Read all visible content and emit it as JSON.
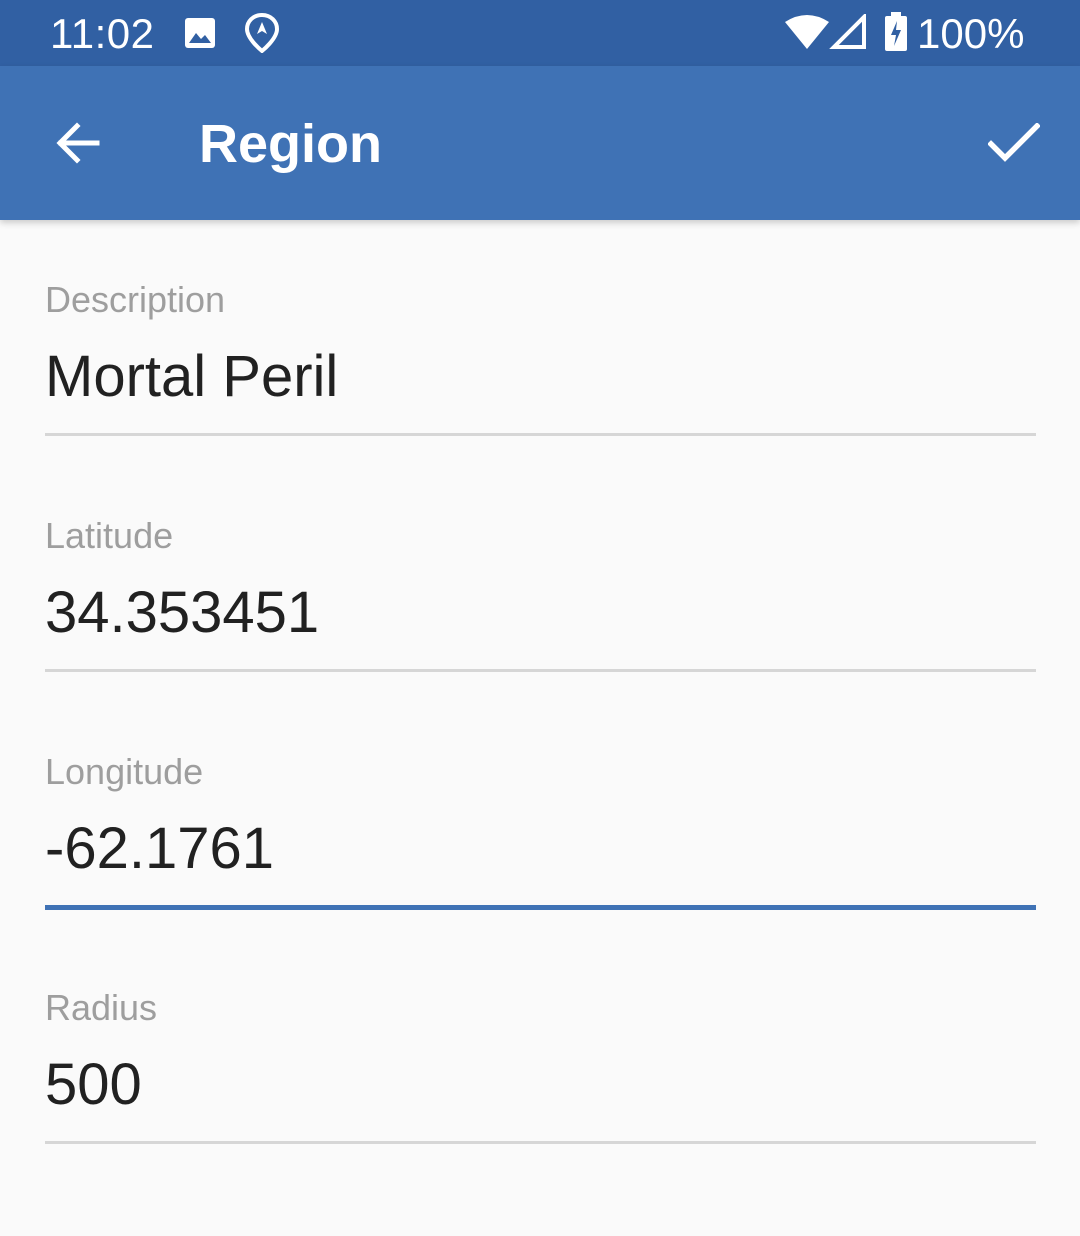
{
  "status_bar": {
    "time": "11:02",
    "battery_percent": "100%",
    "icons": [
      "image-icon",
      "location-pin-icon",
      "wifi-icon",
      "cellular-signal-icon",
      "battery-charging-icon"
    ],
    "background": "#3160a3"
  },
  "app_bar": {
    "title": "Region",
    "back_icon": "arrow-back-icon",
    "confirm_icon": "check-icon",
    "background": "#3f72b5"
  },
  "form": {
    "fields": [
      {
        "label": "Description",
        "value": "Mortal Peril"
      },
      {
        "label": "Latitude",
        "value": "34.353451"
      },
      {
        "label": "Longitude",
        "value": "-62.1761",
        "focused": true
      },
      {
        "label": "Radius",
        "value": "500"
      }
    ],
    "focus_color": "#3f72b5"
  }
}
